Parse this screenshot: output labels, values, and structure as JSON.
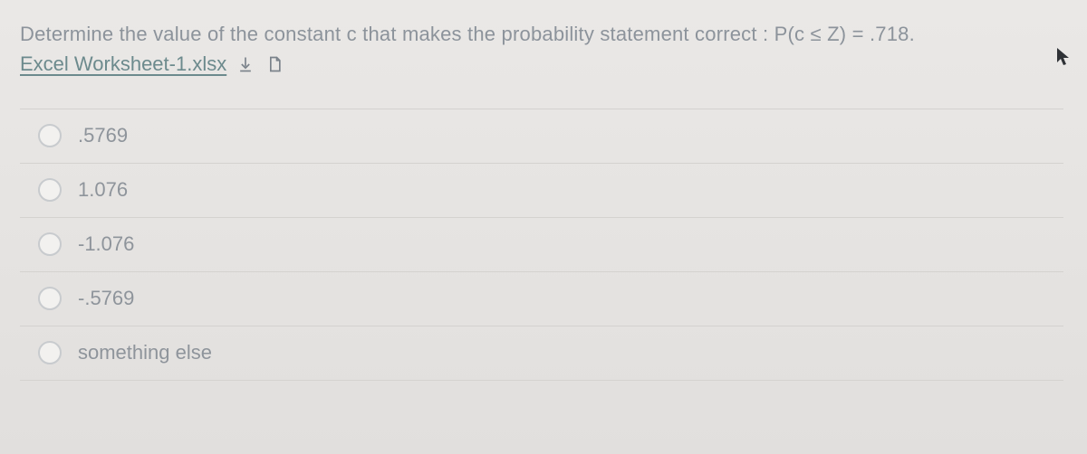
{
  "question": {
    "prompt_text": "Determine the value of the constant c that makes the probability statement correct : P(c ≤ Z) = .718.",
    "attachment_label": "Excel Worksheet-1.xlsx"
  },
  "options": [
    {
      "label": ".5769"
    },
    {
      "label": "1.076"
    },
    {
      "label": "-1.076"
    },
    {
      "label": "-.5769"
    },
    {
      "label": "something else"
    }
  ]
}
